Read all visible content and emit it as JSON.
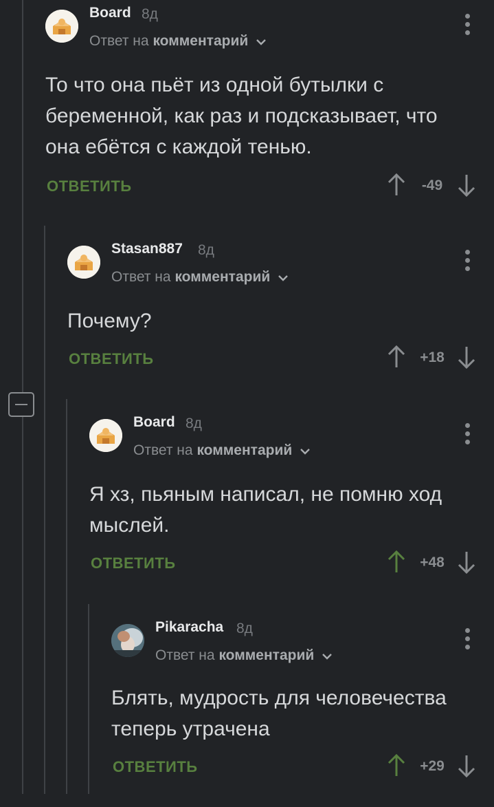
{
  "comments": [
    {
      "username": "Board",
      "age": "8д",
      "reply_prefix": "Ответ на",
      "reply_link": "комментарий",
      "text": "То что она пьёт из одной бутылки с беременной, как раз и подсказывает, что она ебётся с каждой тенью.",
      "reply_label": "ОТВЕТИТЬ",
      "score": "-49",
      "upvoted": false,
      "avatar": "default-avatar"
    },
    {
      "username": "Stasan887",
      "age": "8д",
      "reply_prefix": "Ответ на",
      "reply_link": "комментарий",
      "text": "Почему?",
      "reply_label": "ОТВЕТИТЬ",
      "score": "+18",
      "upvoted": false,
      "avatar": "default-avatar"
    },
    {
      "username": "Board",
      "age": "8д",
      "reply_prefix": "Ответ на",
      "reply_link": "комментарий",
      "text": "Я хз, пьяным написал, не помню ход мыслей.",
      "reply_label": "ОТВЕТИТЬ",
      "score": "+48",
      "upvoted": true,
      "avatar": "default-avatar"
    },
    {
      "username": "Pikaracha",
      "age": "8д",
      "reply_prefix": "Ответ на",
      "reply_link": "комментарий",
      "text": "Блять, мудрость для человечества теперь утрачена",
      "reply_label": "ОТВЕТИТЬ",
      "score": "+29",
      "upvoted": true,
      "avatar": "photo-avatar"
    }
  ],
  "colors": {
    "background": "#212326",
    "accent_green": "#58803f",
    "muted": "#8a8d90",
    "text": "#d6d8da"
  },
  "icons": [
    "default-avatar",
    "chevron-down-icon",
    "more-vertical-icon",
    "arrow-up-icon",
    "arrow-down-icon",
    "collapse-minus-icon"
  ]
}
